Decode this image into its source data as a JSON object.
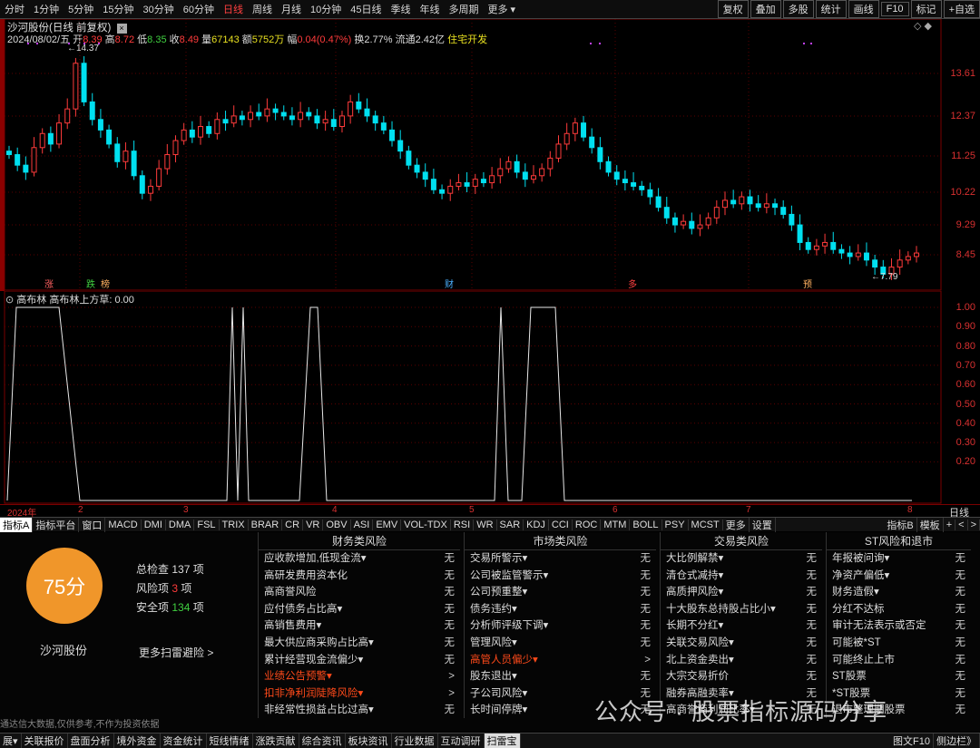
{
  "toolbar": {
    "periods": [
      "分时",
      "1分钟",
      "5分钟",
      "15分钟",
      "30分钟",
      "60分钟",
      "日线",
      "周线",
      "月线",
      "10分钟",
      "45日线",
      "季线",
      "年线",
      "多周期",
      "更多 ▾"
    ],
    "active": "日线",
    "right": [
      "复权",
      "叠加",
      "多股",
      "统计",
      "画线",
      "F10",
      "标记",
      "+自选"
    ]
  },
  "stock": {
    "title": "沙河股份(日线 前复权)",
    "date": "2024/08/02/五",
    "open_l": "开",
    "open": "8.39",
    "high_l": "高",
    "high": "8.72",
    "low_l": "低",
    "low": "8.35",
    "close_l": "收",
    "close": "8.49",
    "vol_l": "量",
    "vol": "67143",
    "amt_l": "额",
    "amt": "5752万",
    "chg_l": "幅",
    "chg": "0.04(0.47%)",
    "turn_l": "换",
    "turn": "2.77%",
    "float_l": "流通",
    "float": "2.42亿",
    "sector": "住宅开发"
  },
  "price_axis": [
    "13.61",
    "12.37",
    "11.25",
    "10.22",
    "9.29",
    "8.45"
  ],
  "price_marks": {
    "high": "14.37",
    "low": "7.79"
  },
  "event_markers": [
    {
      "t": "涨",
      "c": "#ff6060"
    },
    {
      "t": "跌",
      "c": "#40d040"
    },
    {
      "t": "榜",
      "c": "#ffb060"
    },
    {
      "t": "财",
      "c": "#4ab0ff"
    },
    {
      "t": "多",
      "c": "#ff4040"
    },
    {
      "t": "预",
      "c": "#ffb060"
    }
  ],
  "indicator": {
    "name": "高布林",
    "line": "高布林上方草: 0.00"
  },
  "ind_axis": [
    "1.00",
    "0.90",
    "0.80",
    "0.70",
    "0.60",
    "0.50",
    "0.40",
    "0.30",
    "0.20"
  ],
  "time_axis": [
    "2024年",
    "2",
    "3",
    "4",
    "5",
    "6",
    "7",
    "8"
  ],
  "time_axis_right": "日线",
  "indicator_tabs": [
    "指标A",
    "指标平台",
    "窗口",
    "MACD",
    "DMI",
    "DMA",
    "FSL",
    "TRIX",
    "BRAR",
    "CR",
    "VR",
    "OBV",
    "ASI",
    "EMV",
    "VOL-TDX",
    "RSI",
    "WR",
    "SAR",
    "KDJ",
    "CCI",
    "ROC",
    "MTM",
    "BOLL",
    "PSY",
    "MCST",
    "更多",
    "设置"
  ],
  "indicator_tabs_right": [
    "指标B",
    "模板",
    "+",
    "<",
    ">"
  ],
  "score": {
    "value": "75分",
    "name": "沙河股份",
    "total_l": "总检查",
    "total": "137",
    "risk_l": "风险项",
    "risk": "3",
    "safe_l": "安全项",
    "safe": "134",
    "unit": "项",
    "more": "更多扫雷避险 >"
  },
  "columns": [
    {
      "title": "财务类风险",
      "rows": [
        {
          "n": "应收款增加,低现金流▾",
          "v": "无"
        },
        {
          "n": "高研发费用资本化",
          "v": "无"
        },
        {
          "n": "高商誉风险",
          "v": "无"
        },
        {
          "n": "应付债务占比高▾",
          "v": "无"
        },
        {
          "n": "高销售费用▾",
          "v": "无"
        },
        {
          "n": "最大供应商采购占比高▾",
          "v": "无"
        },
        {
          "n": "累计经营现金流偏少▾",
          "v": "无"
        },
        {
          "n": "业绩公告预警▾",
          "v": ">",
          "w": true
        },
        {
          "n": "扣非净利润陡降风险▾",
          "v": ">",
          "w": true
        },
        {
          "n": "非经常性损益占比过高▾",
          "v": "无"
        }
      ]
    },
    {
      "title": "市场类风险",
      "rows": [
        {
          "n": "交易所警示▾",
          "v": "无"
        },
        {
          "n": "公司被监管警示▾",
          "v": "无"
        },
        {
          "n": "公司预重整▾",
          "v": "无"
        },
        {
          "n": "债务违约▾",
          "v": "无"
        },
        {
          "n": "分析师评级下调▾",
          "v": "无"
        },
        {
          "n": "管理风险▾",
          "v": "无"
        },
        {
          "n": "高管人员偏少▾",
          "v": ">",
          "w": true
        },
        {
          "n": "股东退出▾",
          "v": "无"
        },
        {
          "n": "子公司风险▾",
          "v": "无"
        },
        {
          "n": "长时间停牌▾",
          "v": "无"
        }
      ]
    },
    {
      "title": "交易类风险",
      "rows": [
        {
          "n": "大比例解禁▾",
          "v": "无"
        },
        {
          "n": "清仓式减持▾",
          "v": "无"
        },
        {
          "n": "高质押风险▾",
          "v": "无"
        },
        {
          "n": "十大股东总持股占比小▾",
          "v": "无"
        },
        {
          "n": "长期不分红▾",
          "v": "无"
        },
        {
          "n": "关联交易风险▾",
          "v": "无"
        },
        {
          "n": "北上资金卖出▾",
          "v": "无"
        },
        {
          "n": "大宗交易折价",
          "v": "无"
        },
        {
          "n": "融券高融卖率▾",
          "v": "无"
        },
        {
          "n": "高商誉商利润比率▾",
          "v": "无"
        }
      ]
    },
    {
      "title": "ST风险和退市",
      "rows": [
        {
          "n": "年报被问询▾",
          "v": "无"
        },
        {
          "n": "净资产偏低▾",
          "v": "无"
        },
        {
          "n": "财务造假▾",
          "v": "无"
        },
        {
          "n": "分红不达标",
          "v": "无"
        },
        {
          "n": "审计无法表示或否定",
          "v": "无"
        },
        {
          "n": "可能被*ST",
          "v": "无"
        },
        {
          "n": "可能终止上市",
          "v": "无"
        },
        {
          "n": "ST股票",
          "v": "无"
        },
        {
          "n": "*ST股票",
          "v": "无"
        },
        {
          "n": "退市整理期股票",
          "v": "无"
        }
      ]
    }
  ],
  "disclaimer": "通达信大数据,仅供参考,不作为投资依据",
  "watermark": "公众号 · 股票指标源码分享",
  "bottom_tabs": [
    "展▾",
    "关联报价",
    "盘面分析",
    "境外资金",
    "资金统计",
    "短线情绪",
    "涨跌贡献",
    "综合资讯",
    "板块资讯",
    "行业数据",
    "互动调研",
    "扫雷宝"
  ],
  "bottom_active": "扫雷宝",
  "bottom_right": [
    "图文F10",
    "侧边栏》"
  ],
  "colors": {
    "up": "#ff3b3b",
    "down": "#00e0f0",
    "score": "#f0962a",
    "grid": "#7a0000"
  }
}
